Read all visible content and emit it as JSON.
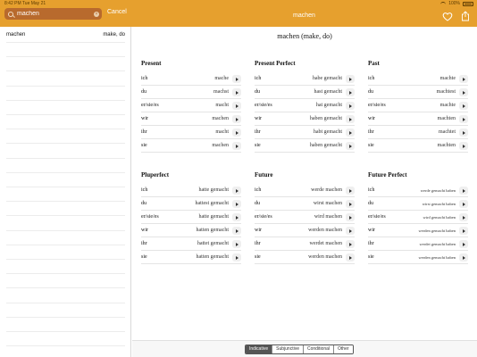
{
  "status": {
    "time": "8:42 PM  Tue May 21",
    "battery": "100%"
  },
  "search": {
    "value": "machen",
    "cancel": "Cancel"
  },
  "title": "machen",
  "sidebar": {
    "items": [
      {
        "word": "machen",
        "translation": "make, do"
      }
    ]
  },
  "main": {
    "heading": "machen (make, do)",
    "tenses": [
      {
        "name": "Present",
        "rows": [
          {
            "p": "ich",
            "f": "mache"
          },
          {
            "p": "du",
            "f": "machst"
          },
          {
            "p": "er/sie/es",
            "f": "macht"
          },
          {
            "p": "wir",
            "f": "machen"
          },
          {
            "p": "ihr",
            "f": "macht"
          },
          {
            "p": "sie",
            "f": "machen"
          }
        ]
      },
      {
        "name": "Present Perfect",
        "rows": [
          {
            "p": "ich",
            "f": "habe gemacht"
          },
          {
            "p": "du",
            "f": "hast gemacht"
          },
          {
            "p": "er/sie/es",
            "f": "hat gemacht"
          },
          {
            "p": "wir",
            "f": "haben gemacht"
          },
          {
            "p": "ihr",
            "f": "habt gemacht"
          },
          {
            "p": "sie",
            "f": "haben gemacht"
          }
        ]
      },
      {
        "name": "Past",
        "rows": [
          {
            "p": "ich",
            "f": "machte"
          },
          {
            "p": "du",
            "f": "machtest"
          },
          {
            "p": "er/sie/es",
            "f": "machte"
          },
          {
            "p": "wir",
            "f": "machten"
          },
          {
            "p": "ihr",
            "f": "machtet"
          },
          {
            "p": "sie",
            "f": "machten"
          }
        ]
      },
      {
        "name": "Pluperfect",
        "rows": [
          {
            "p": "ich",
            "f": "hatte gemacht"
          },
          {
            "p": "du",
            "f": "hattest gemacht"
          },
          {
            "p": "er/sie/es",
            "f": "hatte gemacht"
          },
          {
            "p": "wir",
            "f": "hatten gemacht"
          },
          {
            "p": "ihr",
            "f": "hattet gemacht"
          },
          {
            "p": "sie",
            "f": "hatten gemacht"
          }
        ]
      },
      {
        "name": "Future",
        "rows": [
          {
            "p": "ich",
            "f": "werde machen"
          },
          {
            "p": "du",
            "f": "wirst machen"
          },
          {
            "p": "er/sie/es",
            "f": "wird machen"
          },
          {
            "p": "wir",
            "f": "werden machen"
          },
          {
            "p": "ihr",
            "f": "werdet machen"
          },
          {
            "p": "sie",
            "f": "werden machen"
          }
        ]
      },
      {
        "name": "Future Perfect",
        "rows": [
          {
            "p": "ich",
            "f": "werde gemacht haben"
          },
          {
            "p": "du",
            "f": "wirst gemacht haben"
          },
          {
            "p": "er/sie/es",
            "f": "wird gemacht haben"
          },
          {
            "p": "wir",
            "f": "werden gemacht haben"
          },
          {
            "p": "ihr",
            "f": "werdet gemacht haben"
          },
          {
            "p": "sie",
            "f": "werden gemacht haben"
          }
        ]
      }
    ]
  },
  "bottom": {
    "tabs": [
      "Indicative",
      "Subjunctive",
      "Conditional",
      "Other"
    ],
    "active": "Indicative"
  },
  "colors": {
    "accent": "#e6a02e"
  },
  "icons": {
    "favorite": "heart-icon",
    "share": "share-icon",
    "search": "search-icon",
    "clear": "clear-icon",
    "play": "play-icon"
  }
}
